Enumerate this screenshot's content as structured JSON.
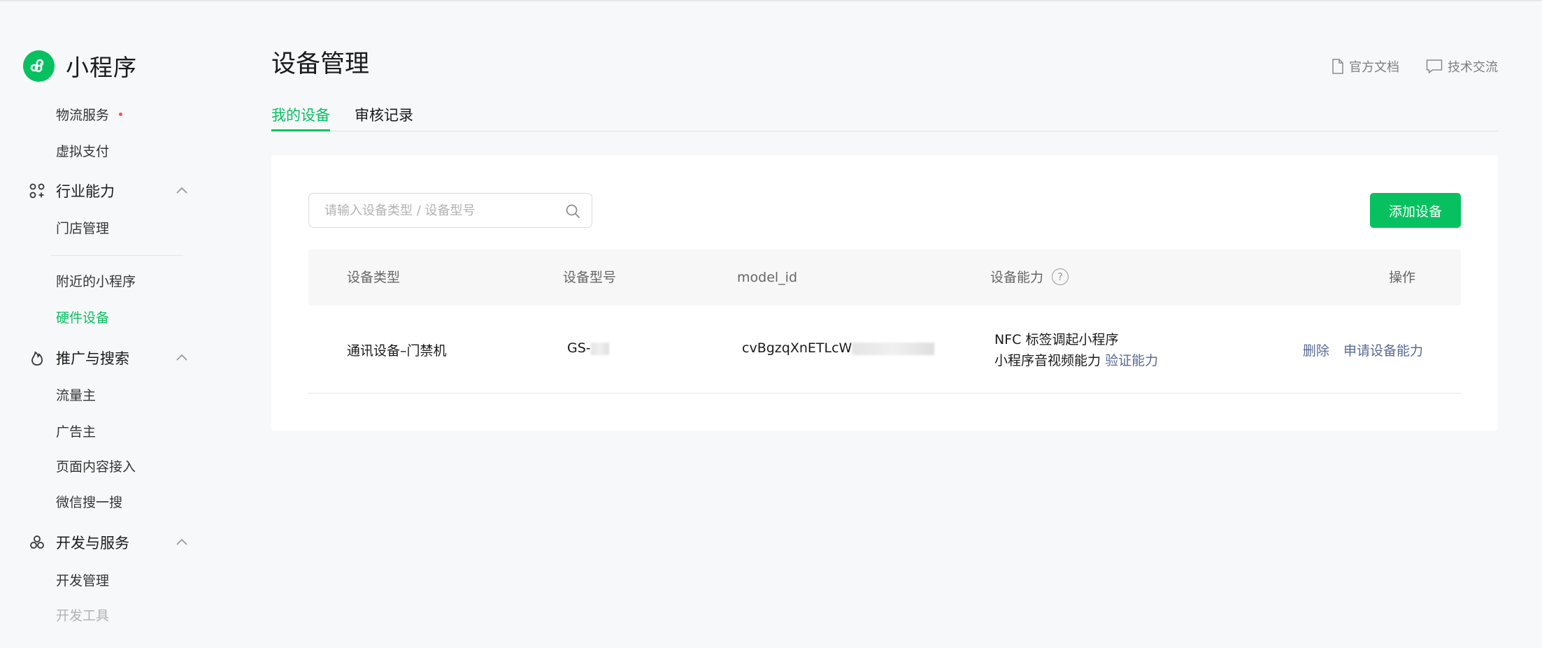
{
  "app": {
    "brand_name": "小程序"
  },
  "sidebar": {
    "items": [
      {
        "label": "物流服务",
        "has_dot": true
      },
      {
        "label": "虚拟支付"
      },
      {
        "label": "门店管理"
      },
      {
        "label": "附近的小程序"
      },
      {
        "label": "硬件设备",
        "active": true
      },
      {
        "label": "流量主"
      },
      {
        "label": "广告主"
      },
      {
        "label": "页面内容接入"
      },
      {
        "label": "微信搜一搜"
      },
      {
        "label": "开发管理"
      },
      {
        "label": "开发工具"
      }
    ],
    "groups": [
      {
        "label": "行业能力",
        "icon": "industry-icon",
        "expanded": true
      },
      {
        "label": "推广与搜索",
        "icon": "flame-icon",
        "expanded": true
      },
      {
        "label": "开发与服务",
        "icon": "develop-icon",
        "expanded": true
      }
    ]
  },
  "header": {
    "title": "设备管理",
    "links": {
      "docs": "官方文档",
      "community": "技术交流"
    }
  },
  "tabs": [
    {
      "label": "我的设备",
      "active": true
    },
    {
      "label": "审核记录",
      "active": false
    }
  ],
  "search": {
    "placeholder": "请输入设备类型 / 设备型号",
    "value": ""
  },
  "toolbar": {
    "add_label": "添加设备"
  },
  "table": {
    "columns": [
      "设备类型",
      "设备型号",
      "model_id",
      "设备能力",
      "操作"
    ],
    "rows": [
      {
        "type": "通讯设备–门禁机",
        "model": "GS-",
        "model_id": "cvBgzqXnETLcW",
        "capabilities": [
          "NFC 标签调起小程序",
          "小程序音视频能力"
        ],
        "verify_label": "验证能力",
        "actions": {
          "delete": "删除",
          "apply": "申请设备能力"
        }
      }
    ]
  },
  "colors": {
    "accent": "#07c160",
    "link": "#576b95",
    "dot": "#fa5151"
  }
}
